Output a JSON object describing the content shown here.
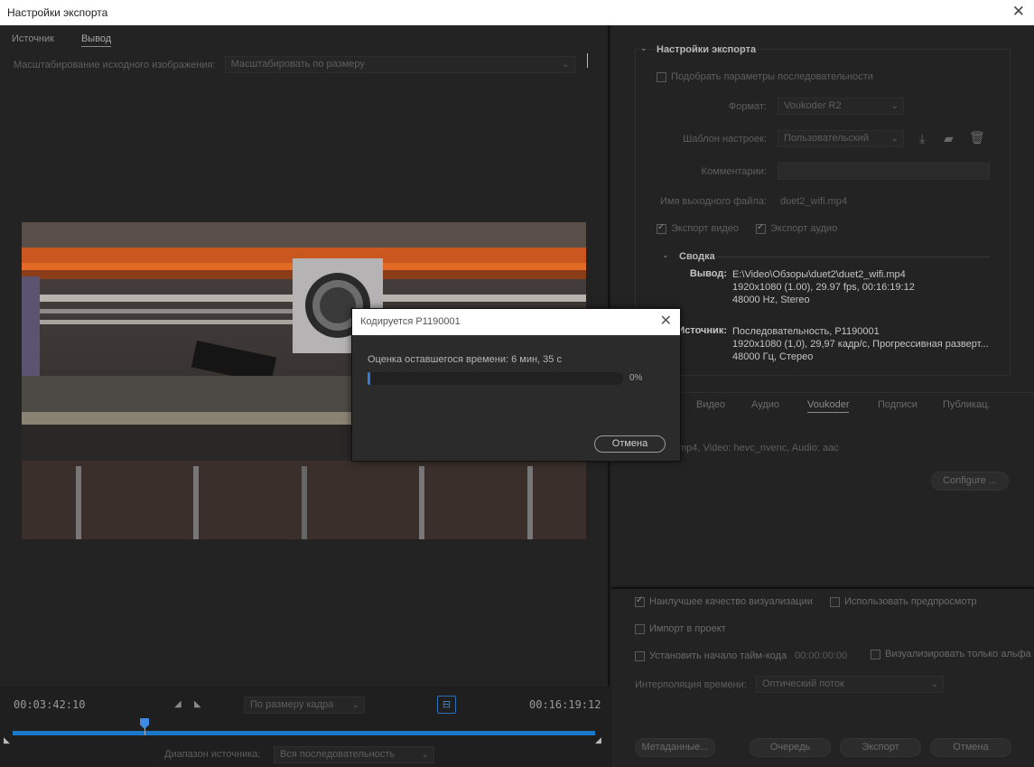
{
  "window": {
    "title": "Настройки экспорта"
  },
  "left": {
    "tabs": [
      "Источник",
      "Вывод"
    ],
    "scaling_label": "Масштабирование исходного изображения:",
    "scaling_value": "Масштабировать по размеру"
  },
  "timeline": {
    "current_time": "00:03:42:10",
    "fit_value": "По размеру кадра",
    "end_time": "00:16:19:12",
    "source_range_label": "Диапазон источника:",
    "source_range_value": "Вся последовательность"
  },
  "export_settings": {
    "title": "Настройки экспорта",
    "match_sequence": "Подобрать параметры последовательности",
    "format_label": "Формат:",
    "format_value": "Voukoder R2",
    "preset_label": "Шаблон настроек:",
    "preset_value": "Пользовательский",
    "comments_label": "Комментарии:",
    "output_name_label": "Имя выходного файла:",
    "output_name_value": "duet2_wifi.mp4",
    "export_video": "Экспорт видео",
    "export_audio": "Экспорт аудио",
    "summary_title": "Сводка",
    "output_label": "Вывод:",
    "output_lines": [
      "E:\\Video\\Обзоры\\duet2\\duet2_wifi.mp4",
      "1920x1080 (1.00), 29.97 fps, 00:16:19:12",
      "48000 Hz, Stereo"
    ],
    "source_label": "Источник:",
    "source_lines": [
      "Последовательность, P1190001",
      "1920x1080 (1,0), 29,97 кадр/с, Прогрессивная разверт...",
      "48000 Гц, Стерео"
    ]
  },
  "codec_tabs": [
    "Видео",
    "Аудио",
    "Voukoder",
    "Подписи",
    "Публикац."
  ],
  "codec_summary": "mp4, Video: hevc_nvenc, Audio: aac",
  "configure_button": "Configure ...",
  "options": {
    "max_render_quality": "Наилучшее качество визуализации",
    "use_previews": "Использовать предпросмотр",
    "import_into_project": "Импорт в проект",
    "set_start_timecode": "Установить начало тайм-кода",
    "start_timecode_value": "00:00:00:00",
    "render_alpha_only": "Визуализировать только альфа",
    "time_interpolation_label": "Интерполяция времени:",
    "time_interpolation_value": "Оптический поток"
  },
  "buttons": {
    "metadata": "Метаданные...",
    "queue": "Очередь",
    "export": "Экспорт",
    "cancel": "Отмена"
  },
  "dialog": {
    "title": "Кодируется P1190001",
    "estimate": "Оценка оставшегося времени: 6 мин, 35 с",
    "progress": 0,
    "progress_text": "0%",
    "cancel": "Отмена"
  }
}
